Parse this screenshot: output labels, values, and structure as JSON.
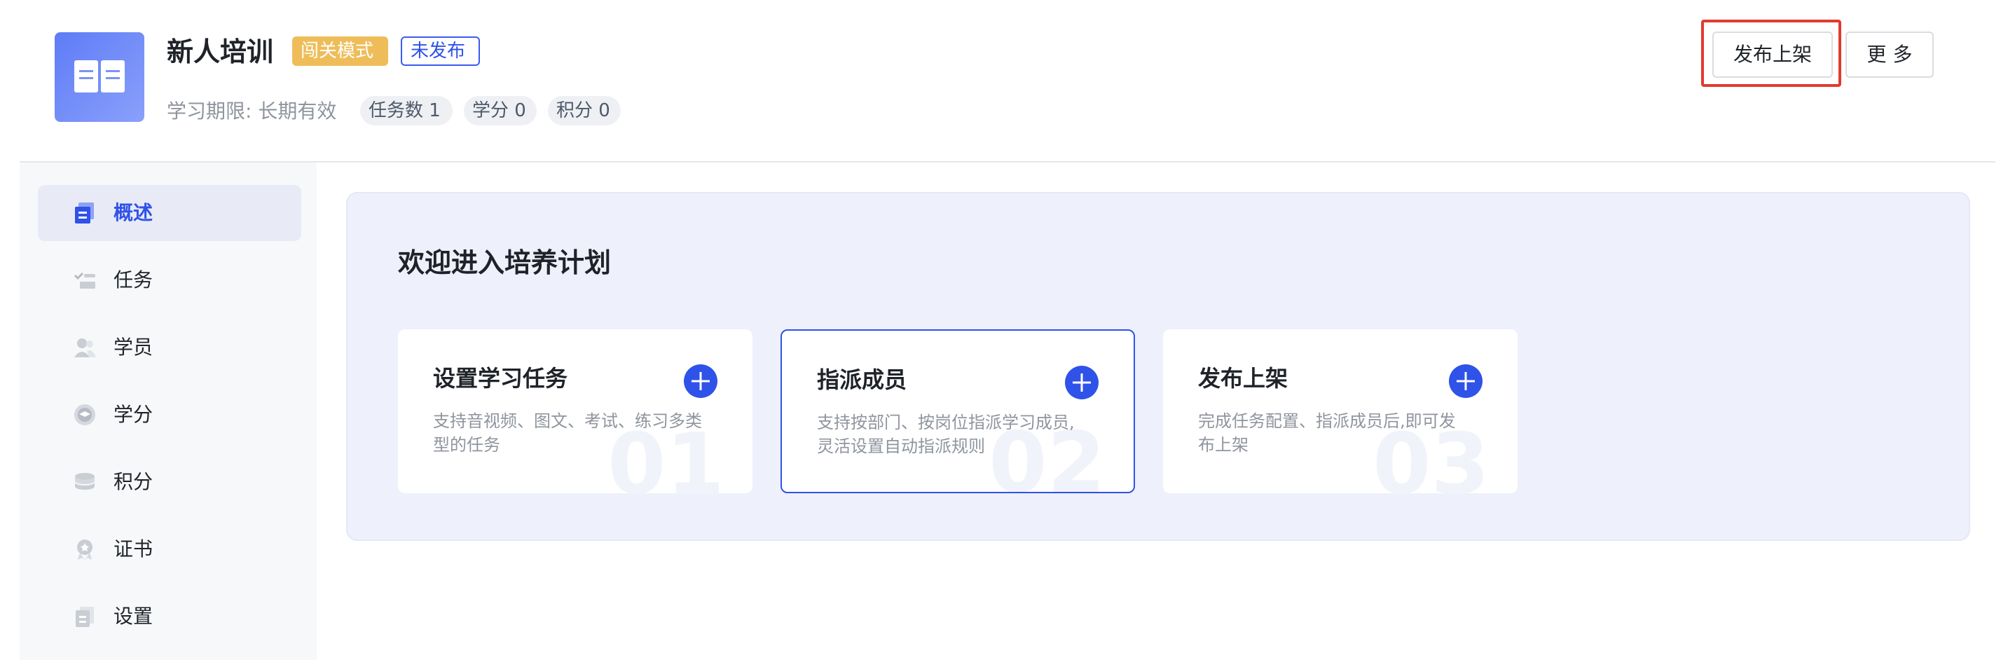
{
  "header": {
    "title": "新人培训",
    "mode_tag": "闯关模式",
    "status_tag": "未发布",
    "meta_label": "学习期限:  长期有效",
    "pills": {
      "tasks": "任务数 1",
      "credit": "学分 0",
      "points": "积分 0"
    },
    "buttons": {
      "publish": "发布上架",
      "more": "更 多"
    }
  },
  "sidebar": {
    "items": [
      {
        "label": "概述",
        "icon": "overview-icon",
        "active": true
      },
      {
        "label": "任务",
        "icon": "task-icon"
      },
      {
        "label": "学员",
        "icon": "student-icon"
      },
      {
        "label": "学分",
        "icon": "credit-icon"
      },
      {
        "label": "积分",
        "icon": "points-icon"
      },
      {
        "label": "证书",
        "icon": "certificate-icon"
      },
      {
        "label": "设置",
        "icon": "settings-icon"
      }
    ]
  },
  "main": {
    "welcome_title": "欢迎进入培养计划",
    "cards": [
      {
        "title": "设置学习任务",
        "desc": "支持音视频、图文、考试、练习多类型的任务",
        "number": "01"
      },
      {
        "title": "指派成员",
        "desc": "支持按部门、按岗位指派学习成员,灵活设置自动指派规则",
        "number": "02"
      },
      {
        "title": "发布上架",
        "desc": "完成任务配置、指派成员后,即可发布上架",
        "number": "03"
      }
    ]
  },
  "colors": {
    "accent": "#2f52e8",
    "mode_tag": "#eebd5a",
    "highlight": "#e23a2f"
  }
}
